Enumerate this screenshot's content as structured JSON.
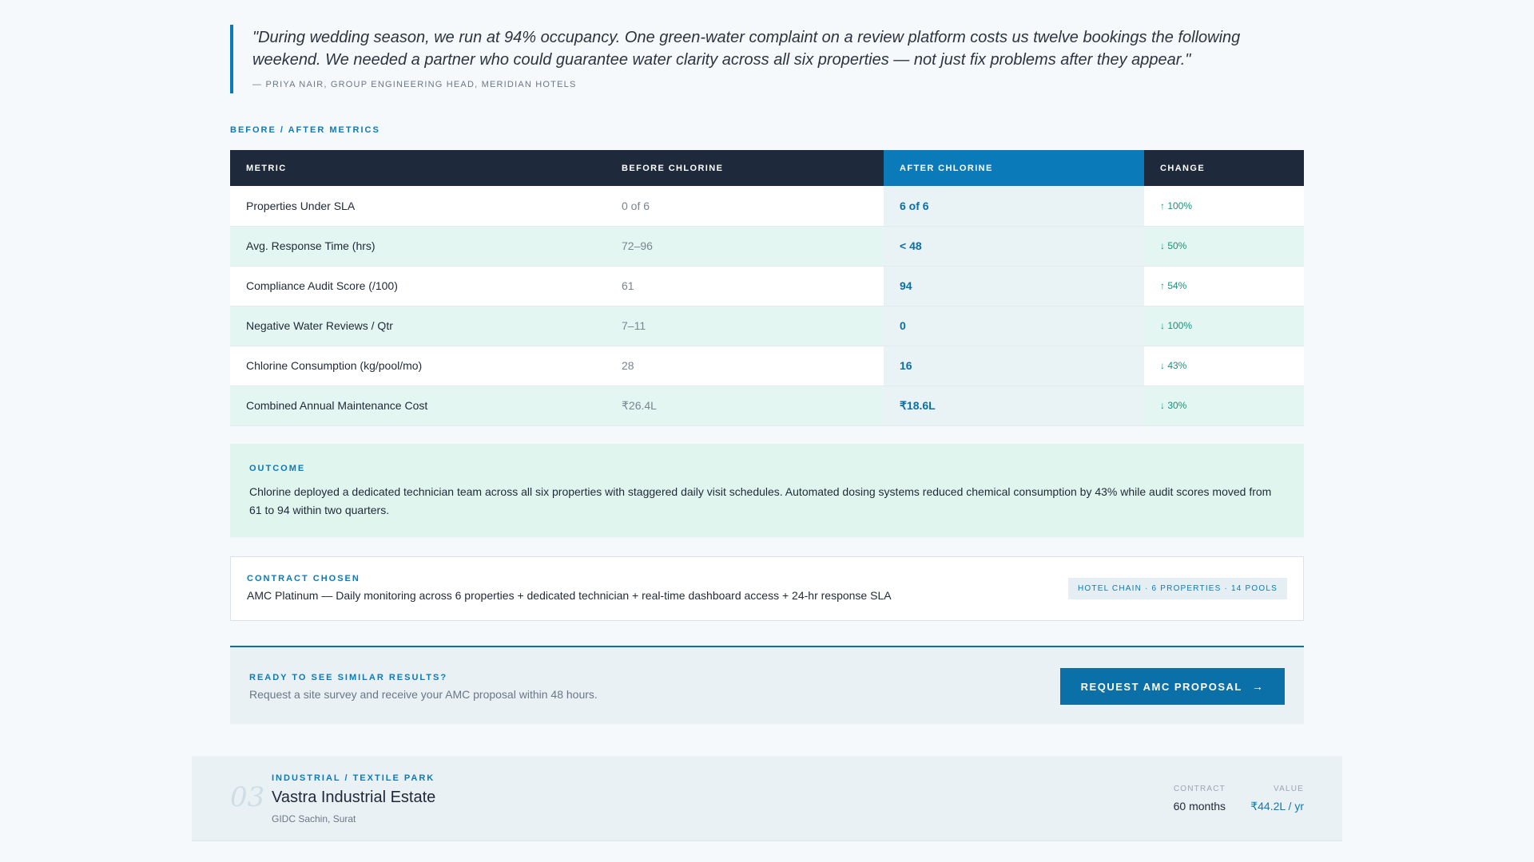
{
  "testimonial": {
    "quote": "\"During wedding season, we run at 94% occupancy. One green-water complaint on a review platform costs us twelve bookings the following weekend. We needed a partner who could guarantee water clarity across all six properties — not just fix problems after they appear.\"",
    "author": "— PRIYA NAIR, GROUP ENGINEERING HEAD, MERIDIAN HOTELS"
  },
  "metrics_section": {
    "label": "BEFORE / AFTER METRICS",
    "headers": [
      "METRIC",
      "BEFORE CHLORINE",
      "AFTER CHLORINE",
      "CHANGE"
    ],
    "rows": [
      {
        "metric": "Properties Under SLA",
        "before": "0 of 6",
        "after": "6 of 6",
        "change": "↑ 100%"
      },
      {
        "metric": "Avg. Response Time (hrs)",
        "before": "72–96",
        "after": "< 48",
        "change": "↓ 50%"
      },
      {
        "metric": "Compliance Audit Score (/100)",
        "before": "61",
        "after": "94",
        "change": "↑ 54%"
      },
      {
        "metric": "Negative Water Reviews / Qtr",
        "before": "7–11",
        "after": "0",
        "change": "↓ 100%"
      },
      {
        "metric": "Chlorine Consumption (kg/pool/mo)",
        "before": "28",
        "after": "16",
        "change": "↓ 43%"
      },
      {
        "metric": "Combined Annual Maintenance Cost",
        "before": "₹26.4L",
        "after": "₹18.6L",
        "change": "↓ 30%"
      }
    ]
  },
  "outcome": {
    "label": "OUTCOME",
    "text": "Chlorine deployed a dedicated technician team across all six properties with staggered daily visit schedules. Automated dosing systems reduced chemical consumption by 43% while audit scores moved from 61 to 94 within two quarters."
  },
  "contract": {
    "label": "CONTRACT CHOSEN",
    "text": "AMC Platinum — Daily monitoring across 6 properties + dedicated technician + real-time dashboard access + 24-hr response SLA",
    "tag": "HOTEL CHAIN · 6 PROPERTIES · 14 POOLS"
  },
  "cta": {
    "label": "READY TO SEE SIMILAR RESULTS?",
    "text": "Request a site survey and receive your AMC proposal within 48 hours.",
    "button": "REQUEST AMC PROPOSAL",
    "button_icon": "→"
  },
  "next_case": {
    "number": "03",
    "category": "INDUSTRIAL / TEXTILE PARK",
    "title": "Vastra Industrial Estate",
    "location": "GIDC Sachin, Surat",
    "contract_label": "CONTRACT",
    "contract_value": "60 months",
    "value_label": "VALUE",
    "value": "₹44.2L / yr"
  },
  "colors": {
    "accent": "#0b7ab8",
    "dark_header": "#1e293b",
    "positive_change": "#18927a",
    "row_tint": "#e4f6f1"
  }
}
